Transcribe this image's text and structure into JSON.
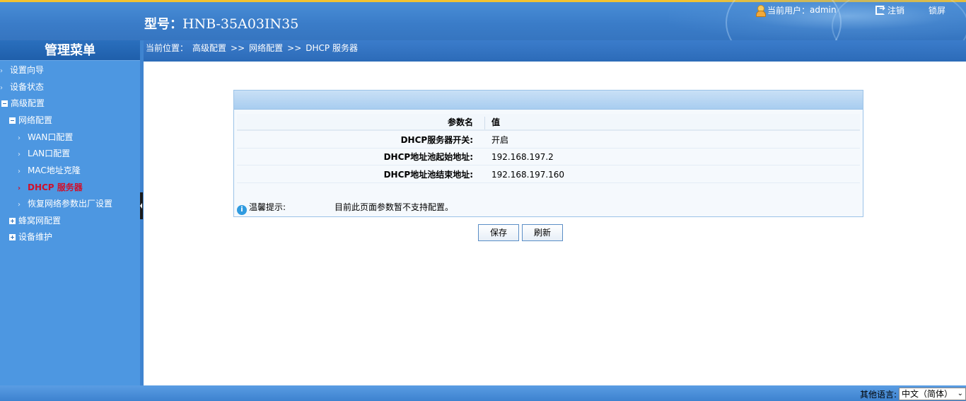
{
  "header": {
    "model_label": "型号：",
    "model_value": "HNB-35A03IN35",
    "user_prefix": "当前用户：",
    "username": "admin",
    "logout": "注销",
    "lock": "锁屏"
  },
  "sidebar": {
    "title": "管理菜单",
    "items": [
      {
        "label": "设置向导",
        "type": "arrow"
      },
      {
        "label": "设备状态",
        "type": "arrow"
      },
      {
        "label": "高级配置",
        "type": "minus"
      },
      {
        "label": "网络配置",
        "type": "minus"
      },
      {
        "label": "WAN口配置",
        "type": "arrow"
      },
      {
        "label": "LAN口配置",
        "type": "arrow"
      },
      {
        "label": "MAC地址克隆",
        "type": "arrow"
      },
      {
        "label": "DHCP 服务器",
        "type": "arrow",
        "active": true
      },
      {
        "label": "恢复网络参数出厂设置",
        "type": "arrow"
      },
      {
        "label": "蜂窝网配置",
        "type": "plus"
      },
      {
        "label": "设备维护",
        "type": "plus"
      }
    ]
  },
  "breadcrumb": {
    "prefix": "当前位置：",
    "level1": "高级配置",
    "sep": ">>",
    "level2": "网络配置",
    "level3": "DHCP 服务器"
  },
  "table": {
    "header_key": "参数名",
    "header_value": "值",
    "rows": [
      {
        "key": "DHCP服务器开关:",
        "value": "开启"
      },
      {
        "key": "DHCP地址池起始地址:",
        "value": "192.168.197.2"
      },
      {
        "key": "DHCP地址池结束地址:",
        "value": "192.168.197.160"
      }
    ]
  },
  "tip": {
    "label": "温馨提示:",
    "text": "目前此页面参数暂不支持配置。"
  },
  "buttons": {
    "save": "保存",
    "refresh": "刷新"
  },
  "footer": {
    "lang_label": "其他语言:",
    "lang_selected": "中文（简体）"
  }
}
